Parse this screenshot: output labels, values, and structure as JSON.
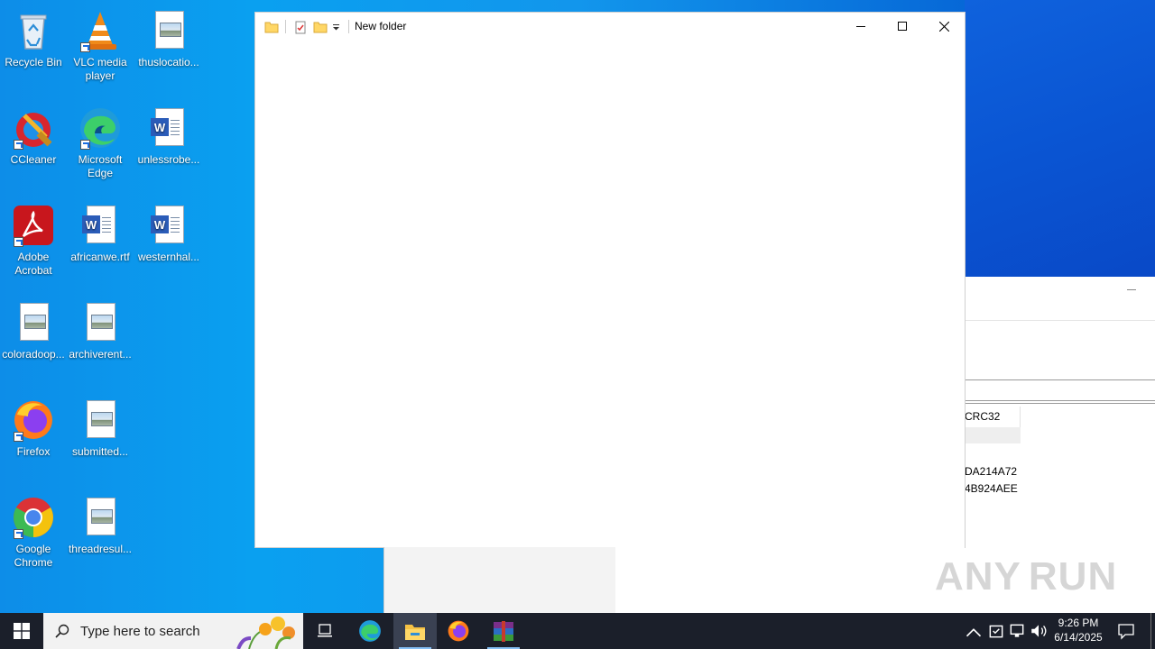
{
  "desktop": {
    "icons": [
      {
        "label": "Recycle Bin"
      },
      {
        "label": "VLC media player"
      },
      {
        "label": "thuslocatio..."
      },
      {
        "label": "CCleaner"
      },
      {
        "label": "Microsoft Edge"
      },
      {
        "label": "unlessrobe..."
      },
      {
        "label": "Adobe Acrobat"
      },
      {
        "label": "africanwe.rtf"
      },
      {
        "label": "westernhal..."
      },
      {
        "label": "coloradoop..."
      },
      {
        "label": "archiverent..."
      },
      {
        "label": "Firefox"
      },
      {
        "label": "submitted..."
      },
      {
        "label": "Google Chrome"
      },
      {
        "label": "threadresul..."
      }
    ]
  },
  "explorer": {
    "title": "New folder",
    "buttons": {
      "minimize": "minimize",
      "maximize": "maximize",
      "close": "close"
    }
  },
  "right_panel": {
    "column_header": "CRC32",
    "values": [
      "DA214A72",
      "4B924AEE"
    ]
  },
  "watermark": "ANY RUN",
  "taskbar": {
    "search_placeholder": "Type here to search",
    "time": "9:26 PM",
    "date": "6/14/2025",
    "accent": "#86c0f5"
  }
}
